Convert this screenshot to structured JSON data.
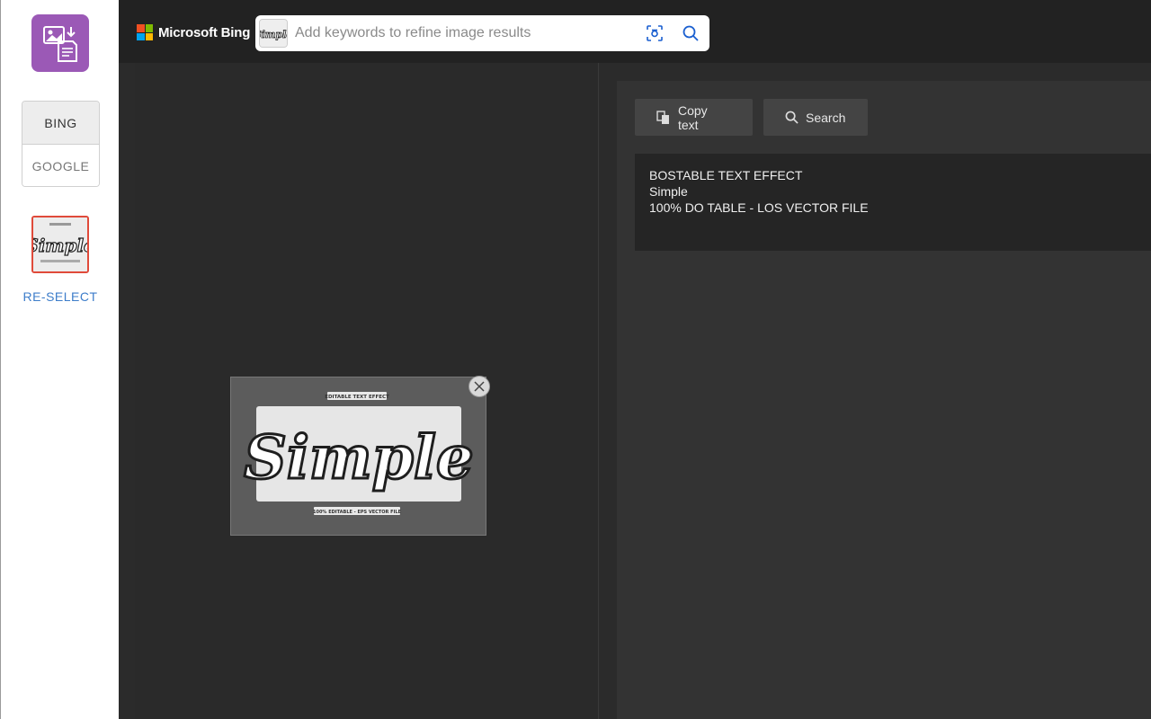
{
  "sidebar": {
    "engines": [
      {
        "label": "BING",
        "active": true
      },
      {
        "label": "GOOGLE",
        "active": false
      }
    ],
    "thumbnail_word": "Simple",
    "reselect_label": "RE-SELECT",
    "logo_icon": "image-convert-icon",
    "accent_color": "#9b59b6",
    "selected_border_color": "#e04a3a"
  },
  "header": {
    "brand": "Microsoft Bing",
    "search": {
      "placeholder": "Add keywords to refine image results",
      "value": ""
    },
    "icons": [
      "visual-search-icon",
      "search-icon"
    ],
    "brand_colors": [
      "#f25022",
      "#7fba00",
      "#00a4ef",
      "#ffb900"
    ]
  },
  "preview": {
    "headline": "EDITABLE TEXT EFFECT",
    "word": "Simple",
    "footer": "100% EDITABLE - EPS VECTOR FILE"
  },
  "results": {
    "copy_label": "Copy text",
    "search_label": "Search",
    "extracted_text": [
      "BOSTABLE TEXT EFFECT",
      "Simple",
      "100% DO TABLE - LOS VECTOR FILE"
    ]
  }
}
